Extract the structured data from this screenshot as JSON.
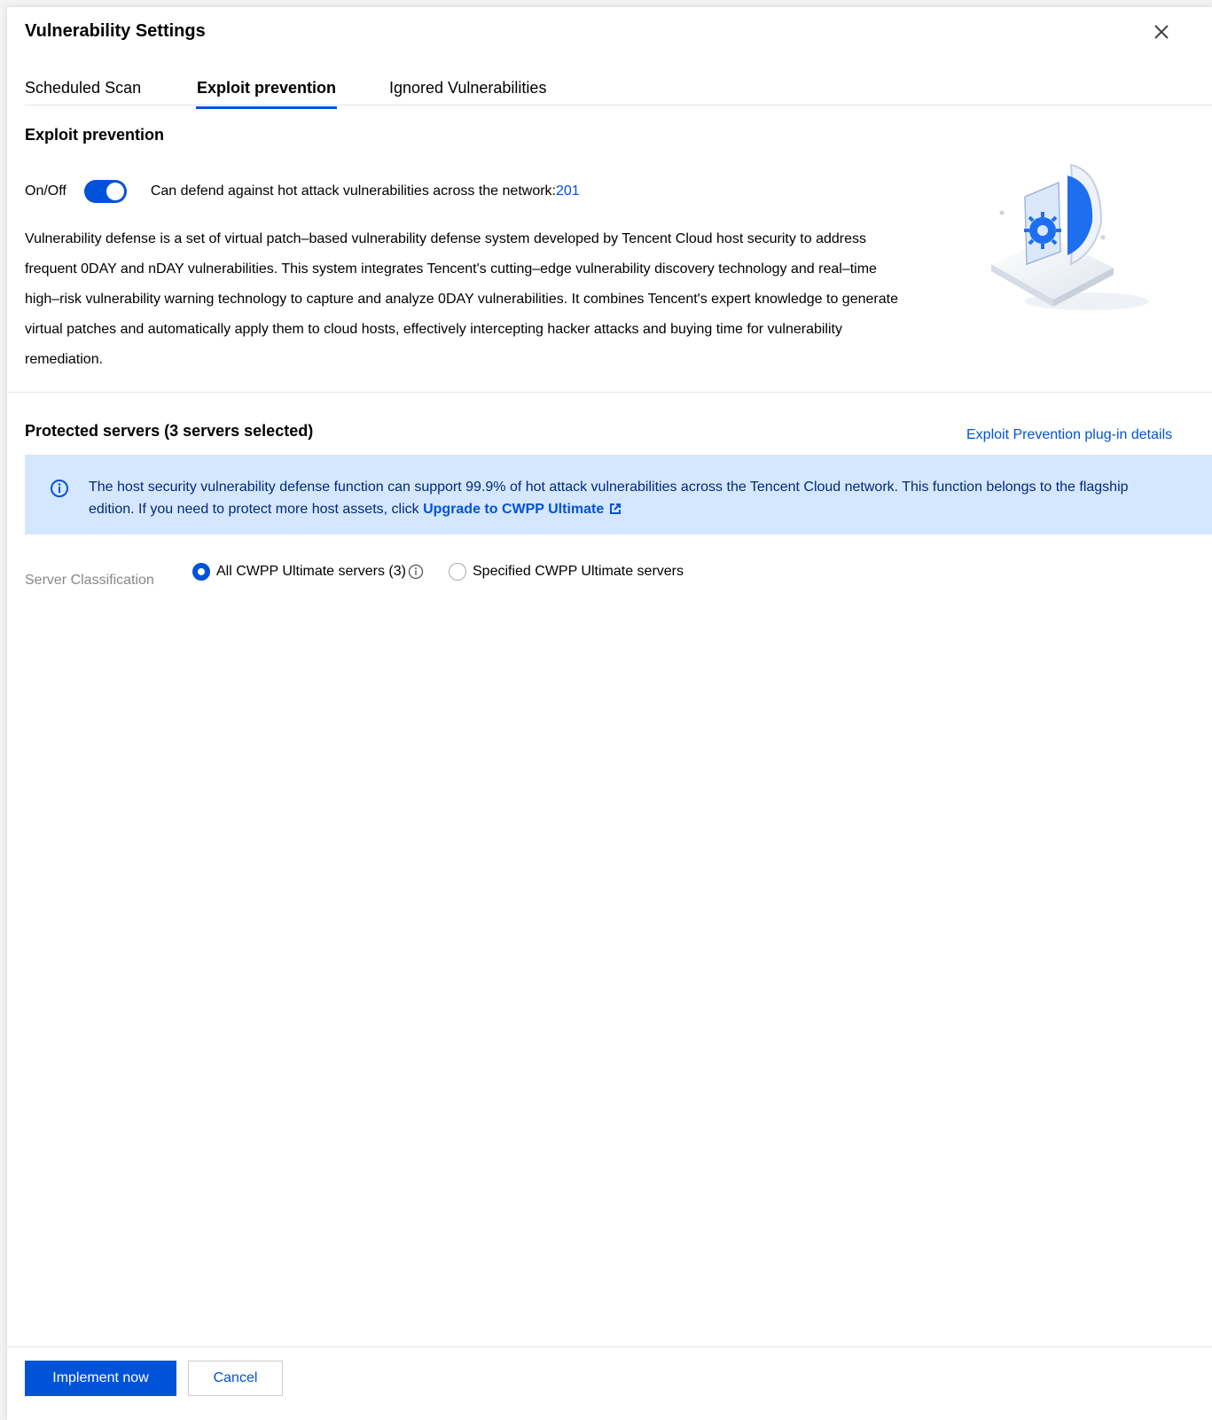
{
  "dialog": {
    "title": "Vulnerability Settings"
  },
  "tabs": [
    {
      "label": "Scheduled Scan"
    },
    {
      "label": "Exploit prevention",
      "active": true
    },
    {
      "label": "Ignored Vulnerabilities"
    }
  ],
  "exploit": {
    "heading": "Exploit prevention",
    "toggle_label": "On/Off",
    "toggle_on": true,
    "defend_text": "Can defend against hot attack vulnerabilities across the network:",
    "defend_count": "201",
    "description": "Vulnerability defense is a set of virtual patch–based vulnerability defense system developed by Tencent Cloud host security to address frequent 0DAY and nDAY vulnerabilities. This system integrates Tencent's cutting–edge vulnerability discovery technology and real–time high–risk vulnerability warning technology to capture and analyze 0DAY vulnerabilities. It combines Tencent's expert knowledge to generate virtual patches and automatically apply them to cloud hosts, effectively intercepting hacker attacks and buying time for vulnerability remediation."
  },
  "protected": {
    "heading": "Protected servers (3 servers selected)",
    "plugin_link": "Exploit Prevention plug-in details",
    "notice_text": "The host security vulnerability defense function can support 99.9% of hot attack vulnerabilities across the Tencent Cloud network. This function belongs to the flagship edition. If you need to protect more host assets, click ",
    "upgrade_link": "Upgrade to CWPP Ultimate",
    "classification_label": "Server Classification",
    "options": [
      {
        "label": "All CWPP Ultimate servers (3)",
        "selected": true
      },
      {
        "label": "Specified CWPP Ultimate servers",
        "selected": false
      }
    ]
  },
  "footer": {
    "primary": "Implement now",
    "secondary": "Cancel"
  },
  "colors": {
    "primary": "#0052d9",
    "notice_bg": "#d5e7ff",
    "notice_text": "#002a7a"
  },
  "icons": [
    "close-icon",
    "info-circle-icon",
    "external-link-icon",
    "shield-illustration"
  ]
}
